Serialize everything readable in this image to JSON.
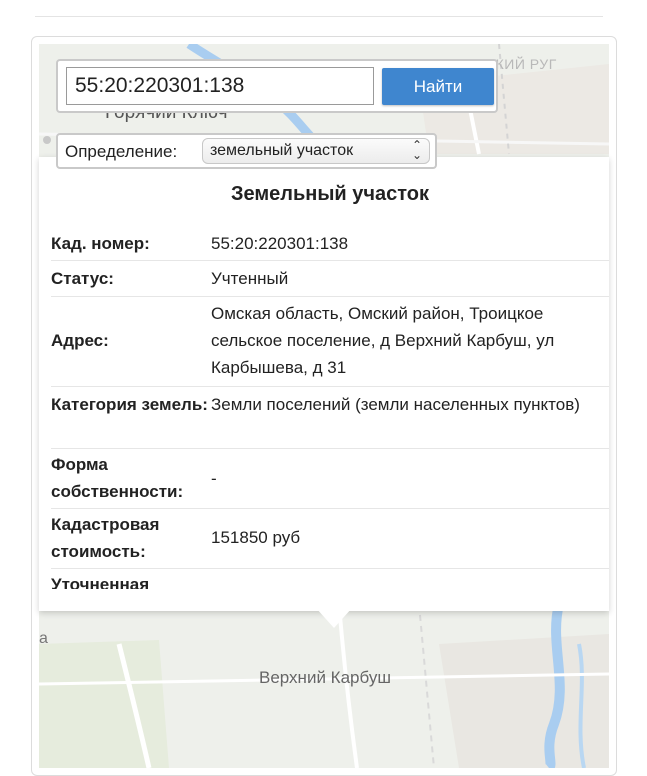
{
  "search": {
    "value": "55:20:220301:138",
    "button_label": "Найти"
  },
  "definition": {
    "label": "Определение:",
    "selected": "земельный участок",
    "chevron": "⌃⌄"
  },
  "map": {
    "labels": {
      "town_top": "Горячий Ключ",
      "district": "СКИЙ РУГ",
      "village": "Верхний Карбуш",
      "edge": "а"
    },
    "colors": {
      "land": "#eef0eb",
      "river": "#a9cdf0",
      "road": "#ffffff",
      "field": "#e3ead8"
    }
  },
  "popup": {
    "title": "Земельный участок",
    "rows": [
      {
        "key": "Кад. номер:",
        "value": "55:20:220301:138"
      },
      {
        "key": "Статус:",
        "value": "Учтенный"
      },
      {
        "key": "Адрес:",
        "value": "Омская область, Омский район, Троицкое сельское поселение, д Верхний Карбуш, ул Карбышева, д 31"
      },
      {
        "key": "Категория земель:",
        "value": "Земли поселений (земли населенных пунктов)"
      },
      {
        "key": "Форма собственности:",
        "value": "-"
      },
      {
        "key": "Кадастровая стоимость:",
        "value": "151850 руб"
      },
      {
        "key": "Уточненная",
        "value": ""
      }
    ]
  }
}
